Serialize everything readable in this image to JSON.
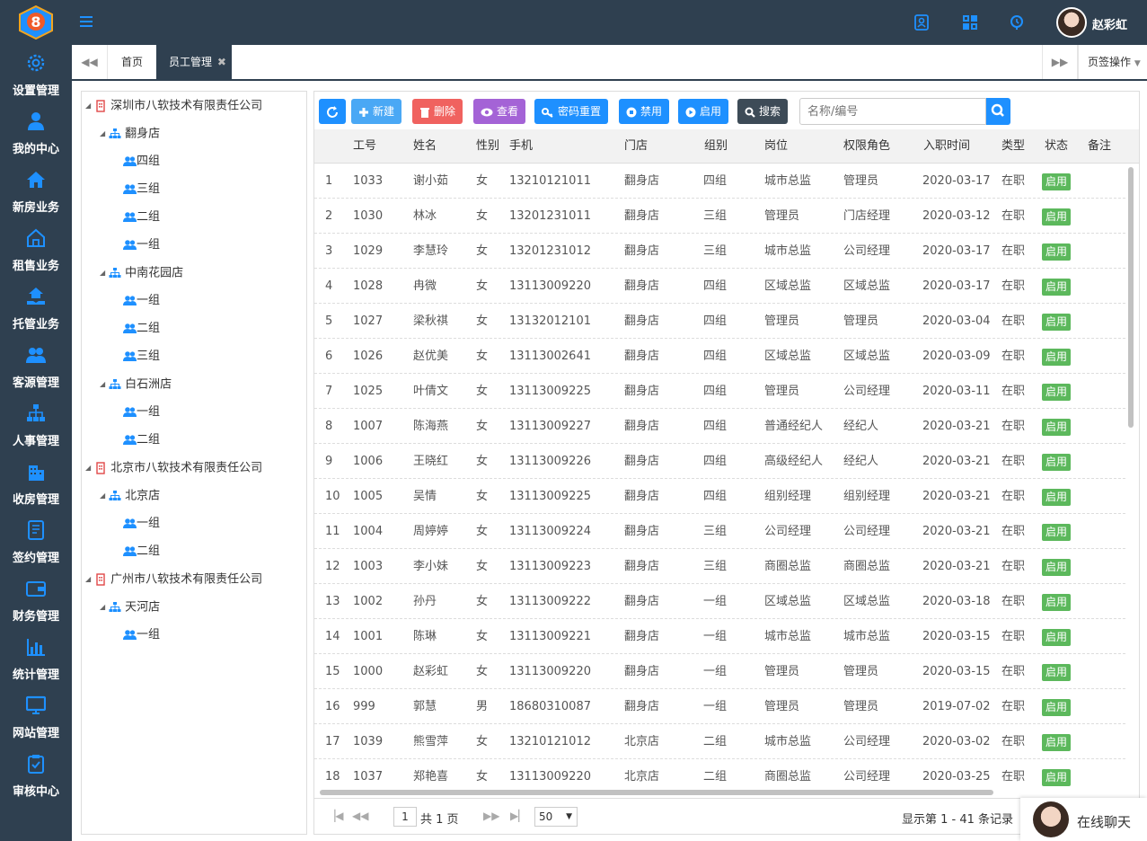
{
  "header": {
    "username": "赵彩虹",
    "logo_text": "8",
    "icons": [
      "user-card-icon",
      "grid-icon",
      "clock-icon"
    ]
  },
  "sidebar": {
    "items": [
      {
        "label": "设置管理",
        "icon": "gear-icon"
      },
      {
        "label": "我的中心",
        "icon": "user-icon"
      },
      {
        "label": "新房业务",
        "icon": "home-icon"
      },
      {
        "label": "租售业务",
        "icon": "house-outline-icon"
      },
      {
        "label": "托管业务",
        "icon": "hand-home-icon"
      },
      {
        "label": "客源管理",
        "icon": "users-icon"
      },
      {
        "label": "人事管理",
        "icon": "org-chart-icon"
      },
      {
        "label": "收房管理",
        "icon": "building-icon"
      },
      {
        "label": "签约管理",
        "icon": "contract-icon"
      },
      {
        "label": "财务管理",
        "icon": "wallet-icon"
      },
      {
        "label": "统计管理",
        "icon": "bar-chart-icon"
      },
      {
        "label": "网站管理",
        "icon": "monitor-icon"
      },
      {
        "label": "审核中心",
        "icon": "clipboard-check-icon"
      }
    ]
  },
  "tabs": {
    "items": [
      {
        "label": "首页",
        "active": false
      },
      {
        "label": "员工管理",
        "active": true
      }
    ],
    "page_ops": "页签操作"
  },
  "tree": {
    "nodes": [
      {
        "label": "深圳市八软技术有限责任公司",
        "level": 0,
        "type": "company"
      },
      {
        "label": "翻身店",
        "level": 1,
        "type": "store"
      },
      {
        "label": "四组",
        "level": 2,
        "type": "group"
      },
      {
        "label": "三组",
        "level": 2,
        "type": "group"
      },
      {
        "label": "二组",
        "level": 2,
        "type": "group"
      },
      {
        "label": "一组",
        "level": 2,
        "type": "group"
      },
      {
        "label": "中南花园店",
        "level": 1,
        "type": "store"
      },
      {
        "label": "一组",
        "level": 2,
        "type": "group"
      },
      {
        "label": "二组",
        "level": 2,
        "type": "group"
      },
      {
        "label": "三组",
        "level": 2,
        "type": "group"
      },
      {
        "label": "白石洲店",
        "level": 1,
        "type": "store"
      },
      {
        "label": "一组",
        "level": 2,
        "type": "group"
      },
      {
        "label": "二组",
        "level": 2,
        "type": "group"
      },
      {
        "label": "北京市八软技术有限责任公司",
        "level": 0,
        "type": "company"
      },
      {
        "label": "北京店",
        "level": 1,
        "type": "store"
      },
      {
        "label": "一组",
        "level": 2,
        "type": "group"
      },
      {
        "label": "二组",
        "level": 2,
        "type": "group"
      },
      {
        "label": "广州市八软技术有限责任公司",
        "level": 0,
        "type": "company"
      },
      {
        "label": "天河店",
        "level": 1,
        "type": "store"
      },
      {
        "label": "一组",
        "level": 2,
        "type": "group"
      }
    ]
  },
  "toolbar": {
    "new": "新建",
    "delete": "删除",
    "view": "查看",
    "reset_pwd": "密码重置",
    "disable": "禁用",
    "enable": "启用",
    "search": "搜索",
    "search_placeholder": "名称/编号"
  },
  "colors": {
    "dark": "#2f4050",
    "primary": "#1e90ff",
    "danger": "#f0625f",
    "purple": "#a463d6",
    "search": "#3d4b57",
    "status": "#5cb85c"
  },
  "table": {
    "columns": [
      "工号",
      "姓名",
      "性别",
      "手机",
      "门店",
      "组别",
      "岗位",
      "权限角色",
      "入职时间",
      "类型",
      "状态",
      "备注"
    ],
    "rows": [
      {
        "no": "1",
        "id": "1033",
        "name": "谢小茹",
        "sex": "女",
        "phone": "13210121011",
        "store": "翻身店",
        "group": "四组",
        "post": "城市总监",
        "role": "管理员",
        "date": "2020-03-17",
        "type": "在职",
        "status": "启用"
      },
      {
        "no": "2",
        "id": "1030",
        "name": "林冰",
        "sex": "女",
        "phone": "13201231011",
        "store": "翻身店",
        "group": "三组",
        "post": "管理员",
        "role": "门店经理",
        "date": "2020-03-12",
        "type": "在职",
        "status": "启用"
      },
      {
        "no": "3",
        "id": "1029",
        "name": "李慧玲",
        "sex": "女",
        "phone": "13201231012",
        "store": "翻身店",
        "group": "三组",
        "post": "城市总监",
        "role": "公司经理",
        "date": "2020-03-17",
        "type": "在职",
        "status": "启用"
      },
      {
        "no": "4",
        "id": "1028",
        "name": "冉微",
        "sex": "女",
        "phone": "13113009220",
        "store": "翻身店",
        "group": "四组",
        "post": "区域总监",
        "role": "区域总监",
        "date": "2020-03-17",
        "type": "在职",
        "status": "启用"
      },
      {
        "no": "5",
        "id": "1027",
        "name": "梁秋祺",
        "sex": "女",
        "phone": "13132012101",
        "store": "翻身店",
        "group": "四组",
        "post": "管理员",
        "role": "管理员",
        "date": "2020-03-04",
        "type": "在职",
        "status": "启用"
      },
      {
        "no": "6",
        "id": "1026",
        "name": "赵优美",
        "sex": "女",
        "phone": "13113002641",
        "store": "翻身店",
        "group": "四组",
        "post": "区域总监",
        "role": "区域总监",
        "date": "2020-03-09",
        "type": "在职",
        "status": "启用"
      },
      {
        "no": "7",
        "id": "1025",
        "name": "叶倩文",
        "sex": "女",
        "phone": "13113009225",
        "store": "翻身店",
        "group": "四组",
        "post": "管理员",
        "role": "公司经理",
        "date": "2020-03-11",
        "type": "在职",
        "status": "启用"
      },
      {
        "no": "8",
        "id": "1007",
        "name": "陈海燕",
        "sex": "女",
        "phone": "13113009227",
        "store": "翻身店",
        "group": "四组",
        "post": "普通经纪人",
        "role": "经纪人",
        "date": "2020-03-21",
        "type": "在职",
        "status": "启用"
      },
      {
        "no": "9",
        "id": "1006",
        "name": "王晓红",
        "sex": "女",
        "phone": "13113009226",
        "store": "翻身店",
        "group": "四组",
        "post": "高级经纪人",
        "role": "经纪人",
        "date": "2020-03-21",
        "type": "在职",
        "status": "启用"
      },
      {
        "no": "10",
        "id": "1005",
        "name": "吴情",
        "sex": "女",
        "phone": "13113009225",
        "store": "翻身店",
        "group": "四组",
        "post": "组别经理",
        "role": "组别经理",
        "date": "2020-03-21",
        "type": "在职",
        "status": "启用"
      },
      {
        "no": "11",
        "id": "1004",
        "name": "周婷婷",
        "sex": "女",
        "phone": "13113009224",
        "store": "翻身店",
        "group": "三组",
        "post": "公司经理",
        "role": "公司经理",
        "date": "2020-03-21",
        "type": "在职",
        "status": "启用"
      },
      {
        "no": "12",
        "id": "1003",
        "name": "李小妹",
        "sex": "女",
        "phone": "13113009223",
        "store": "翻身店",
        "group": "三组",
        "post": "商圈总监",
        "role": "商圈总监",
        "date": "2020-03-21",
        "type": "在职",
        "status": "启用"
      },
      {
        "no": "13",
        "id": "1002",
        "name": "孙丹",
        "sex": "女",
        "phone": "13113009222",
        "store": "翻身店",
        "group": "一组",
        "post": "区域总监",
        "role": "区域总监",
        "date": "2020-03-18",
        "type": "在职",
        "status": "启用"
      },
      {
        "no": "14",
        "id": "1001",
        "name": "陈琳",
        "sex": "女",
        "phone": "13113009221",
        "store": "翻身店",
        "group": "一组",
        "post": "城市总监",
        "role": "城市总监",
        "date": "2020-03-15",
        "type": "在职",
        "status": "启用"
      },
      {
        "no": "15",
        "id": "1000",
        "name": "赵彩虹",
        "sex": "女",
        "phone": "13113009220",
        "store": "翻身店",
        "group": "一组",
        "post": "管理员",
        "role": "管理员",
        "date": "2020-03-15",
        "type": "在职",
        "status": "启用"
      },
      {
        "no": "16",
        "id": "999",
        "name": "郭慧",
        "sex": "男",
        "phone": "18680310087",
        "store": "翻身店",
        "group": "一组",
        "post": "管理员",
        "role": "管理员",
        "date": "2019-07-02",
        "type": "在职",
        "status": "启用"
      },
      {
        "no": "17",
        "id": "1039",
        "name": "熊雪萍",
        "sex": "女",
        "phone": "13210121012",
        "store": "北京店",
        "group": "二组",
        "post": "城市总监",
        "role": "公司经理",
        "date": "2020-03-02",
        "type": "在职",
        "status": "启用"
      },
      {
        "no": "18",
        "id": "1037",
        "name": "郑艳喜",
        "sex": "女",
        "phone": "13113009220",
        "store": "北京店",
        "group": "二组",
        "post": "商圈总监",
        "role": "公司经理",
        "date": "2020-03-25",
        "type": "在职",
        "status": "启用"
      }
    ]
  },
  "pager": {
    "page": "1",
    "total_pages_text": "共 1 页",
    "page_size": "50",
    "summary": "显示第 1 - 41 条记录"
  },
  "chat": {
    "label": "在线聊天"
  }
}
